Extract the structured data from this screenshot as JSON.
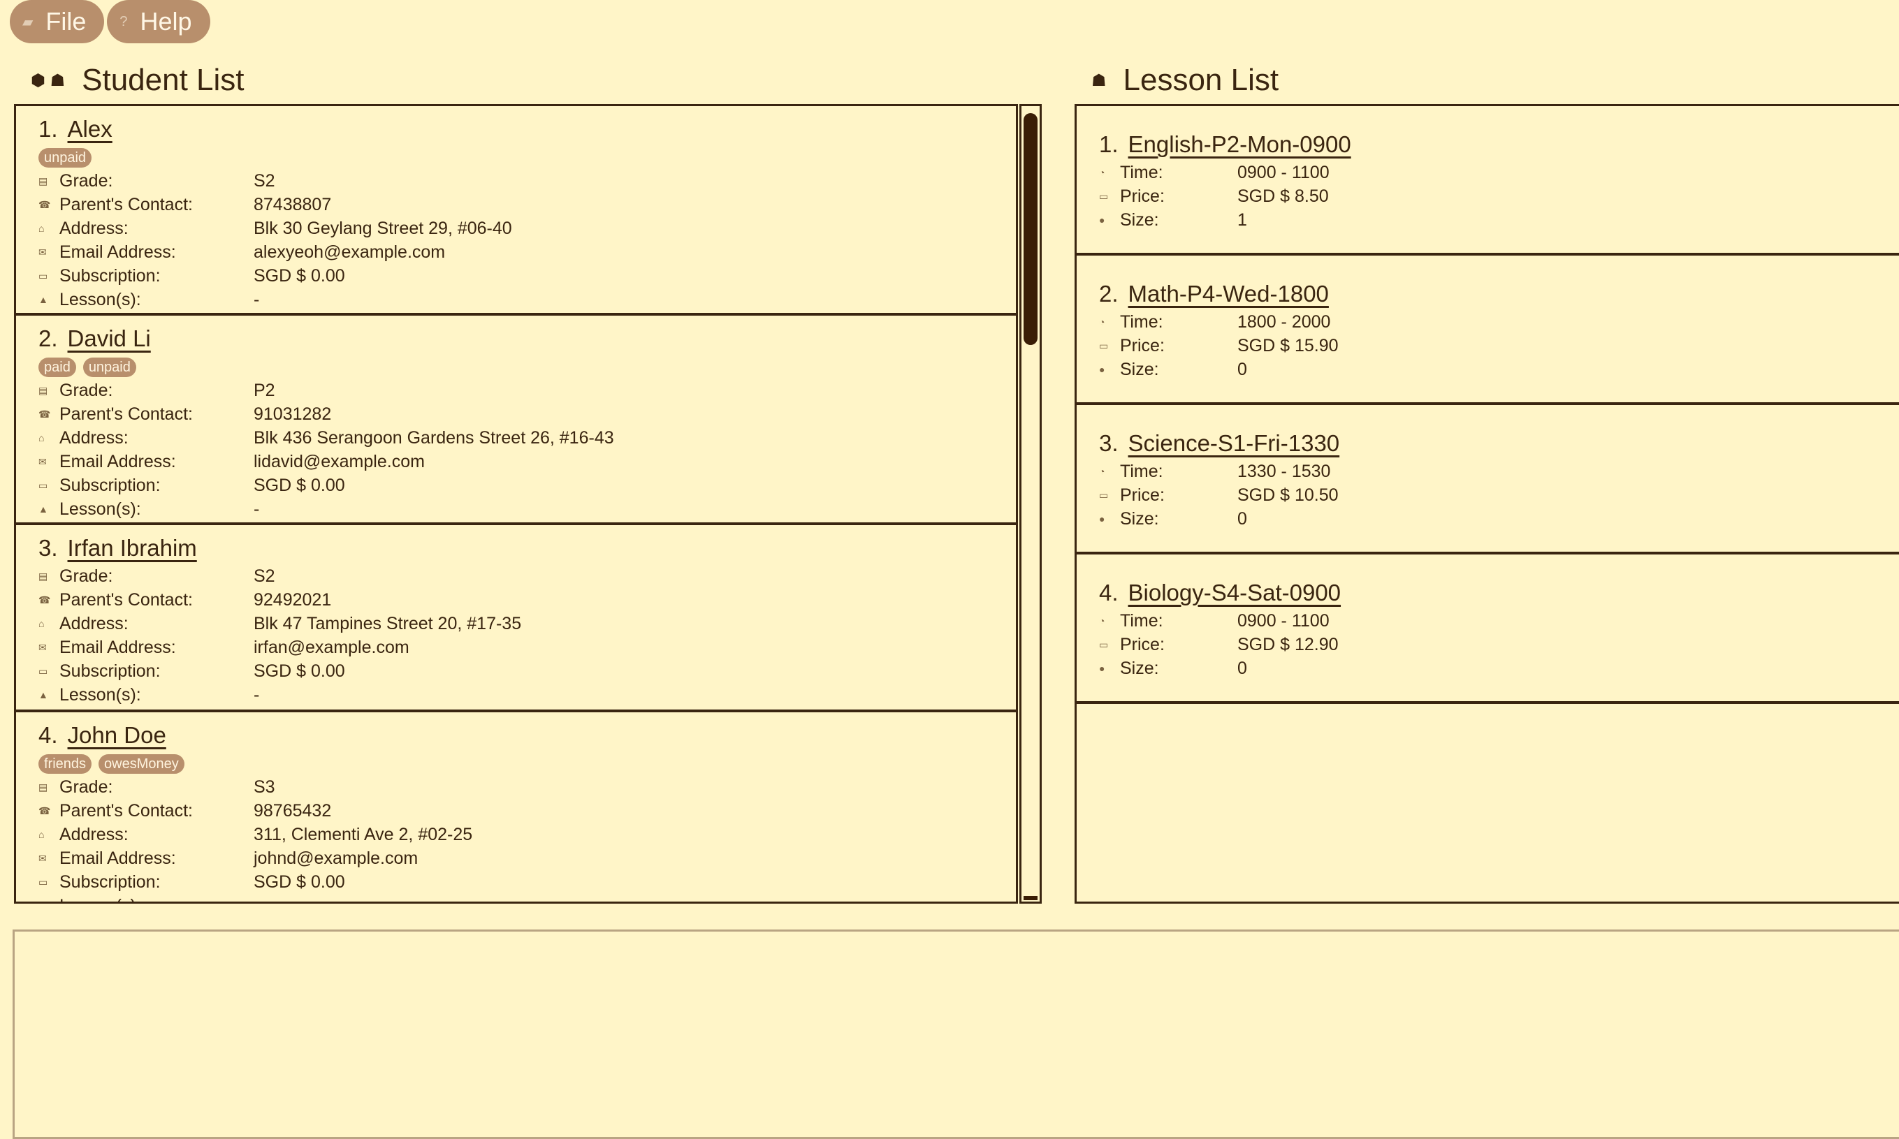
{
  "menu": {
    "file_label": "File",
    "help_label": "Help"
  },
  "student_panel": {
    "title": "Student List",
    "students": [
      {
        "index": "1.",
        "name": "Alex",
        "tags": [
          "unpaid"
        ],
        "fields": [
          {
            "icon": "grade-icon",
            "glyph": "▤",
            "label": "Grade:",
            "value": "S2"
          },
          {
            "icon": "phone-icon",
            "glyph": "☎",
            "label": "Parent's Contact:",
            "value": "87438807"
          },
          {
            "icon": "home-icon",
            "glyph": "⌂",
            "label": "Address:",
            "value": "Blk 30 Geylang Street 29, #06-40"
          },
          {
            "icon": "email-icon",
            "glyph": "✉",
            "label": "Email Address:",
            "value": "alexyeoh@example.com"
          },
          {
            "icon": "money-icon",
            "glyph": "▭",
            "label": "Subscription:",
            "value": "SGD $ 0.00"
          },
          {
            "icon": "lesson-icon",
            "glyph": "▲",
            "label": "Lesson(s):",
            "value": "-"
          }
        ]
      },
      {
        "index": "2.",
        "name": "David Li",
        "tags": [
          "paid",
          "unpaid"
        ],
        "fields": [
          {
            "icon": "grade-icon",
            "glyph": "▤",
            "label": "Grade:",
            "value": "P2"
          },
          {
            "icon": "phone-icon",
            "glyph": "☎",
            "label": "Parent's Contact:",
            "value": "91031282"
          },
          {
            "icon": "home-icon",
            "glyph": "⌂",
            "label": "Address:",
            "value": "Blk 436 Serangoon Gardens Street 26, #16-43"
          },
          {
            "icon": "email-icon",
            "glyph": "✉",
            "label": "Email Address:",
            "value": "lidavid@example.com"
          },
          {
            "icon": "money-icon",
            "glyph": "▭",
            "label": "Subscription:",
            "value": "SGD $ 0.00"
          },
          {
            "icon": "lesson-icon",
            "glyph": "▲",
            "label": "Lesson(s):",
            "value": "-"
          }
        ]
      },
      {
        "index": "3.",
        "name": "Irfan Ibrahim",
        "tags": [],
        "fields": [
          {
            "icon": "grade-icon",
            "glyph": "▤",
            "label": "Grade:",
            "value": "S2"
          },
          {
            "icon": "phone-icon",
            "glyph": "☎",
            "label": "Parent's Contact:",
            "value": "92492021"
          },
          {
            "icon": "home-icon",
            "glyph": "⌂",
            "label": "Address:",
            "value": "Blk 47 Tampines Street 20, #17-35"
          },
          {
            "icon": "email-icon",
            "glyph": "✉",
            "label": "Email Address:",
            "value": "irfan@example.com"
          },
          {
            "icon": "money-icon",
            "glyph": "▭",
            "label": "Subscription:",
            "value": "SGD $ 0.00"
          },
          {
            "icon": "lesson-icon",
            "glyph": "▲",
            "label": "Lesson(s):",
            "value": "-"
          }
        ]
      },
      {
        "index": "4.",
        "name": "John Doe",
        "tags": [
          "friends",
          "owesMoney"
        ],
        "fields": [
          {
            "icon": "grade-icon",
            "glyph": "▤",
            "label": "Grade:",
            "value": "S3"
          },
          {
            "icon": "phone-icon",
            "glyph": "☎",
            "label": "Parent's Contact:",
            "value": "98765432"
          },
          {
            "icon": "home-icon",
            "glyph": "⌂",
            "label": "Address:",
            "value": "311, Clementi Ave 2, #02-25"
          },
          {
            "icon": "email-icon",
            "glyph": "✉",
            "label": "Email Address:",
            "value": "johnd@example.com"
          },
          {
            "icon": "money-icon",
            "glyph": "▭",
            "label": "Subscription:",
            "value": "SGD $ 0.00"
          },
          {
            "icon": "lesson-icon",
            "glyph": "▲",
            "label": "Lesson(s):",
            "value": "-"
          }
        ]
      }
    ]
  },
  "lesson_panel": {
    "title": "Lesson List",
    "lessons": [
      {
        "index": "1.",
        "name": "English-P2-Mon-0900",
        "fields": [
          {
            "icon": "clock-icon",
            "glyph": "◔",
            "label": "Time:",
            "value": "0900 - 1100"
          },
          {
            "icon": "money-icon",
            "glyph": "▭",
            "label": "Price:",
            "value": "SGD $ 8.50"
          },
          {
            "icon": "size-icon",
            "glyph": "●",
            "label": "Size:",
            "value": "1"
          }
        ]
      },
      {
        "index": "2.",
        "name": "Math-P4-Wed-1800",
        "fields": [
          {
            "icon": "clock-icon",
            "glyph": "◔",
            "label": "Time:",
            "value": "1800 - 2000"
          },
          {
            "icon": "money-icon",
            "glyph": "▭",
            "label": "Price:",
            "value": "SGD $ 15.90"
          },
          {
            "icon": "size-icon",
            "glyph": "●",
            "label": "Size:",
            "value": "0"
          }
        ]
      },
      {
        "index": "3.",
        "name": "Science-S1-Fri-1330",
        "fields": [
          {
            "icon": "clock-icon",
            "glyph": "◔",
            "label": "Time:",
            "value": "1330 - 1530"
          },
          {
            "icon": "money-icon",
            "glyph": "▭",
            "label": "Price:",
            "value": "SGD $ 10.50"
          },
          {
            "icon": "size-icon",
            "glyph": "●",
            "label": "Size:",
            "value": "0"
          }
        ]
      },
      {
        "index": "4.",
        "name": "Biology-S4-Sat-0900",
        "fields": [
          {
            "icon": "clock-icon",
            "glyph": "◔",
            "label": "Time:",
            "value": "0900 - 1100"
          },
          {
            "icon": "money-icon",
            "glyph": "▭",
            "label": "Price:",
            "value": "SGD $ 12.90"
          },
          {
            "icon": "size-icon",
            "glyph": "●",
            "label": "Size:",
            "value": "0"
          }
        ]
      }
    ]
  },
  "result_box": {
    "text": ""
  }
}
